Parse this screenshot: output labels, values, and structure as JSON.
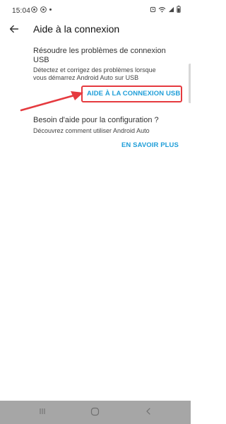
{
  "status_bar": {
    "time": "15:04",
    "left_icons": [
      "chrome-icon",
      "chrome-icon",
      "dot-icon"
    ],
    "right_icons": [
      "alarm-icon",
      "wifi-icon",
      "signal-icon",
      "battery-icon"
    ],
    "battery": "▮"
  },
  "app_bar": {
    "title": "Aide à la connexion"
  },
  "usb_section": {
    "title": "Résoudre les problèmes de connexion USB",
    "description": "Détectez et corrigez des problèmes lorsque vous démarrez Android Auto sur USB",
    "link_label": "AIDE À LA CONNEXION USB"
  },
  "config_section": {
    "title": "Besoin d'aide pour la configuration ?",
    "description": "Découvrez comment utiliser Android Auto",
    "link_label": "EN SAVOIR PLUS"
  },
  "colors": {
    "accent": "#1f9ed8",
    "annotation": "#e53a3f",
    "nav_bar": "#a6a6a6"
  }
}
